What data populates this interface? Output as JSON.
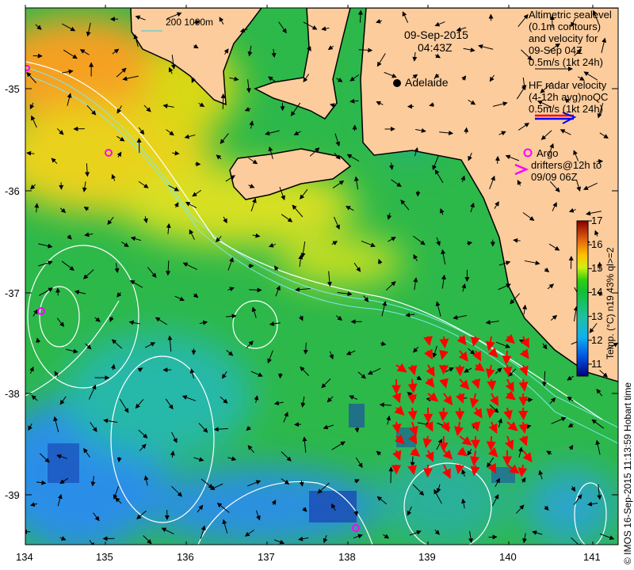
{
  "header": {
    "date": "09-Sep-2015",
    "time": "04:43Z"
  },
  "scale_bar": {
    "label": "200  1000m"
  },
  "places": {
    "city": "Adelaide"
  },
  "legend": {
    "altimetry_lines": [
      "Altimetric sealevel",
      "(0.1m contours)",
      "and velocity for",
      "09-Sep 04Z",
      "0.5m/s (1kt 24h)"
    ],
    "hf_radar_lines": [
      "HF radar velocity",
      "(4-12h avg)noQC",
      "0.5m/s (1kt 24h)"
    ],
    "argo_label": "Argo",
    "drifter_lines": [
      "drifters@12h to",
      "09/09 06Z"
    ]
  },
  "colorbar": {
    "label": "Temp. (°C) n19 43% ql>=2",
    "ticks": [
      "17",
      "16",
      "15",
      "14",
      "13",
      "12",
      "11"
    ],
    "min": 10.5,
    "max": 17
  },
  "axes": {
    "lon_ticks": [
      "134",
      "135",
      "136",
      "137",
      "138",
      "139",
      "140",
      "141"
    ],
    "lat_ticks": [
      "-35",
      "-36",
      "-37",
      "-38",
      "-39"
    ]
  },
  "credit": "© IMOS 16-Sep-2015 11:13:59 Hobart time",
  "colors": {
    "land": "#fccc9c",
    "contour": "#ffffff",
    "isobath": "#7fe8f0",
    "hf_radar": "#ff0000",
    "argo": "#ff00ff"
  }
}
